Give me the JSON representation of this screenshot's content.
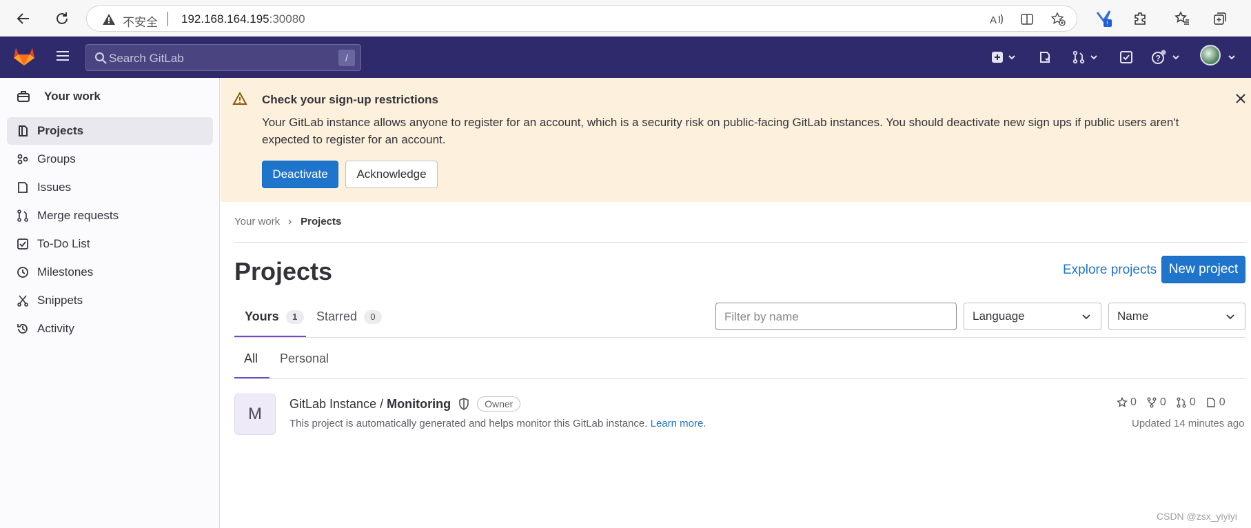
{
  "browser": {
    "insecure_label": "不安全",
    "url_host": "192.168.164.195",
    "url_port": ":30080"
  },
  "header": {
    "search_placeholder": "Search GitLab",
    "search_shortcut": "/"
  },
  "sidebar": {
    "title": "Your work",
    "items": [
      {
        "label": "Projects"
      },
      {
        "label": "Groups"
      },
      {
        "label": "Issues"
      },
      {
        "label": "Merge requests"
      },
      {
        "label": "To-Do List"
      },
      {
        "label": "Milestones"
      },
      {
        "label": "Snippets"
      },
      {
        "label": "Activity"
      }
    ]
  },
  "alert": {
    "title": "Check your sign-up restrictions",
    "body": "Your GitLab instance allows anyone to register for an account, which is a security risk on public-facing GitLab instances. You should deactivate new sign ups if public users aren't expected to register for an account.",
    "primary_button": "Deactivate",
    "secondary_button": "Acknowledge"
  },
  "breadcrumb": {
    "parent": "Your work",
    "current": "Projects"
  },
  "page": {
    "title": "Projects",
    "explore_link": "Explore projects",
    "new_button": "New project"
  },
  "tabs": [
    {
      "label": "Yours",
      "count": "1"
    },
    {
      "label": "Starred",
      "count": "0"
    }
  ],
  "filters": {
    "name_placeholder": "Filter by name",
    "language": "Language",
    "sort": "Name"
  },
  "subtabs": [
    {
      "label": "All"
    },
    {
      "label": "Personal"
    }
  ],
  "project": {
    "avatar_letter": "M",
    "namespace": "GitLab Instance /",
    "name": "Monitoring",
    "role": "Owner",
    "description": "This project is automatically generated and helps monitor this GitLab instance.",
    "learn_more": "Learn more.",
    "stars": "0",
    "forks": "0",
    "merge_requests": "0",
    "issues": "0",
    "updated": "Updated 14 minutes ago"
  },
  "watermark": "CSDN @zsx_yiyiyi",
  "colors": {
    "header_bg": "#2f2a6b",
    "alert_bg": "#fdf1dd",
    "primary": "#1f75cb",
    "tab_underline": "#6e49cb"
  }
}
